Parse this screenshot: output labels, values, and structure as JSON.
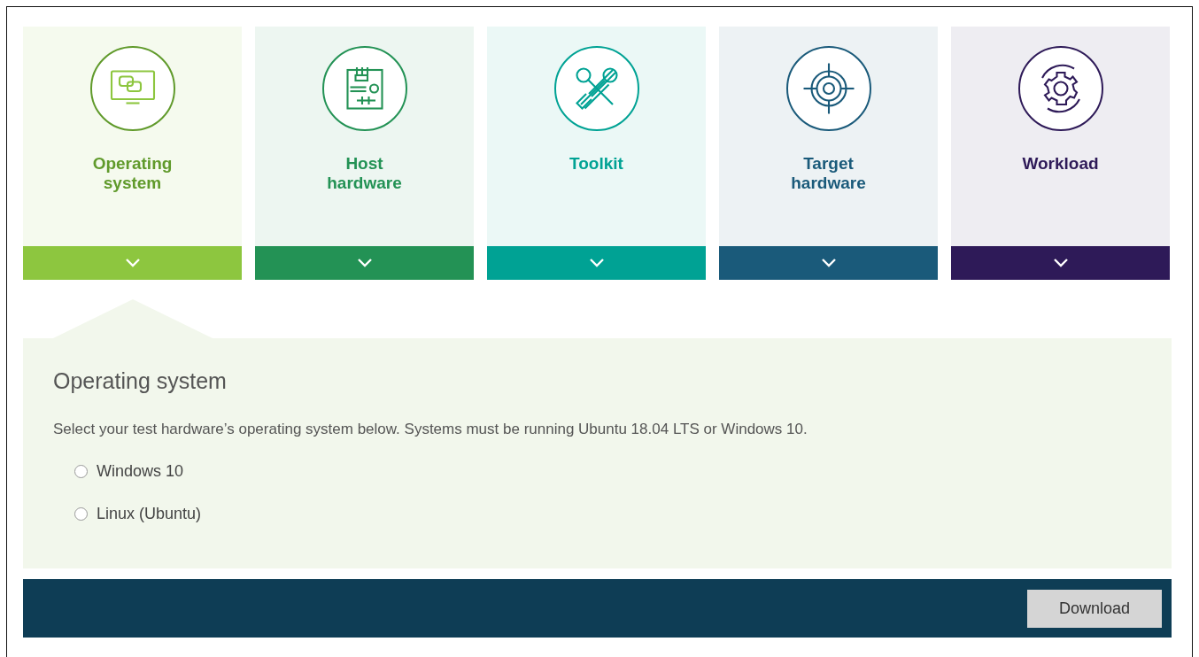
{
  "steps": [
    {
      "label": "Operating system",
      "kind": "monitor",
      "color": "#8dc63f",
      "selected": true
    },
    {
      "label": "Host hardware",
      "kind": "board",
      "color": "#239255",
      "selected": false
    },
    {
      "label": "Toolkit",
      "kind": "tools",
      "color": "#00a294",
      "selected": false
    },
    {
      "label": "Target hardware",
      "kind": "target",
      "color": "#1a5a7a",
      "selected": false
    },
    {
      "label": "Workload",
      "kind": "gear",
      "color": "#2e1a58",
      "selected": false
    }
  ],
  "panel": {
    "title": "Operating system",
    "description": "Select your test hardware’s operating system below. Systems must be running Ubuntu 18.04 LTS or Windows 10.",
    "options": [
      {
        "label": "Windows 10",
        "selected": false
      },
      {
        "label": "Linux (Ubuntu)",
        "selected": false
      }
    ]
  },
  "footer": {
    "button": "Download"
  }
}
